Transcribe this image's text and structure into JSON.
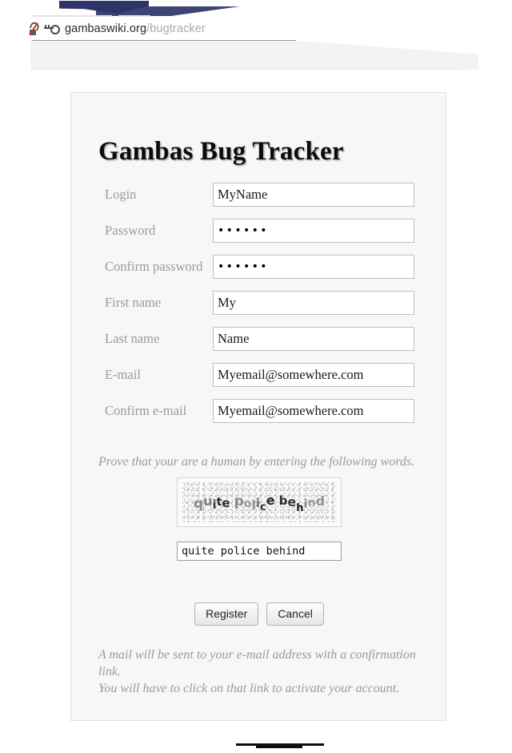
{
  "browser": {
    "url_host": "gambaswiki.org",
    "url_path": "/bugtracker",
    "url_path_faded": "",
    "insecure_icon": "broken-lock-icon",
    "key_icon": "key-icon"
  },
  "page": {
    "title": "Gambas Bug Tracker"
  },
  "form": {
    "fields": [
      {
        "label": "Login",
        "value": "MyName",
        "type": "text"
      },
      {
        "label": "Password",
        "value": "••••••",
        "type": "password"
      },
      {
        "label": "Confirm password",
        "value": "••••••",
        "type": "password"
      },
      {
        "label": "First name",
        "value": "My",
        "type": "text"
      },
      {
        "label": "Last name",
        "value": "Name",
        "type": "text"
      },
      {
        "label": "E-mail",
        "value": "Myemail@somewhere.com",
        "type": "text"
      },
      {
        "label": "Confirm e-mail",
        "value": "Myemail@somewhere.com",
        "type": "text"
      }
    ]
  },
  "captcha": {
    "instruction": "Prove that your are a human by entering the following words.",
    "challenge_text": "quite police behind",
    "input_value": "quite police behind"
  },
  "buttons": {
    "register_label": "Register",
    "cancel_label": "Cancel"
  },
  "footer": {
    "line1": "A mail will be sent to your e-mail address with a confirmation link.",
    "line2": "You will have to click on that link to activate your account."
  },
  "colors": {
    "panel_bg": "#f7f7f7",
    "panel_border": "#dfdfdf",
    "label_gray": "#9b9b9b",
    "note_gray": "#9a9a9a",
    "title_black": "#0c0c0c",
    "input_border": "#bfbfbf",
    "chrome_navy": "#2e3468",
    "insecure_red": "#c0392b"
  }
}
